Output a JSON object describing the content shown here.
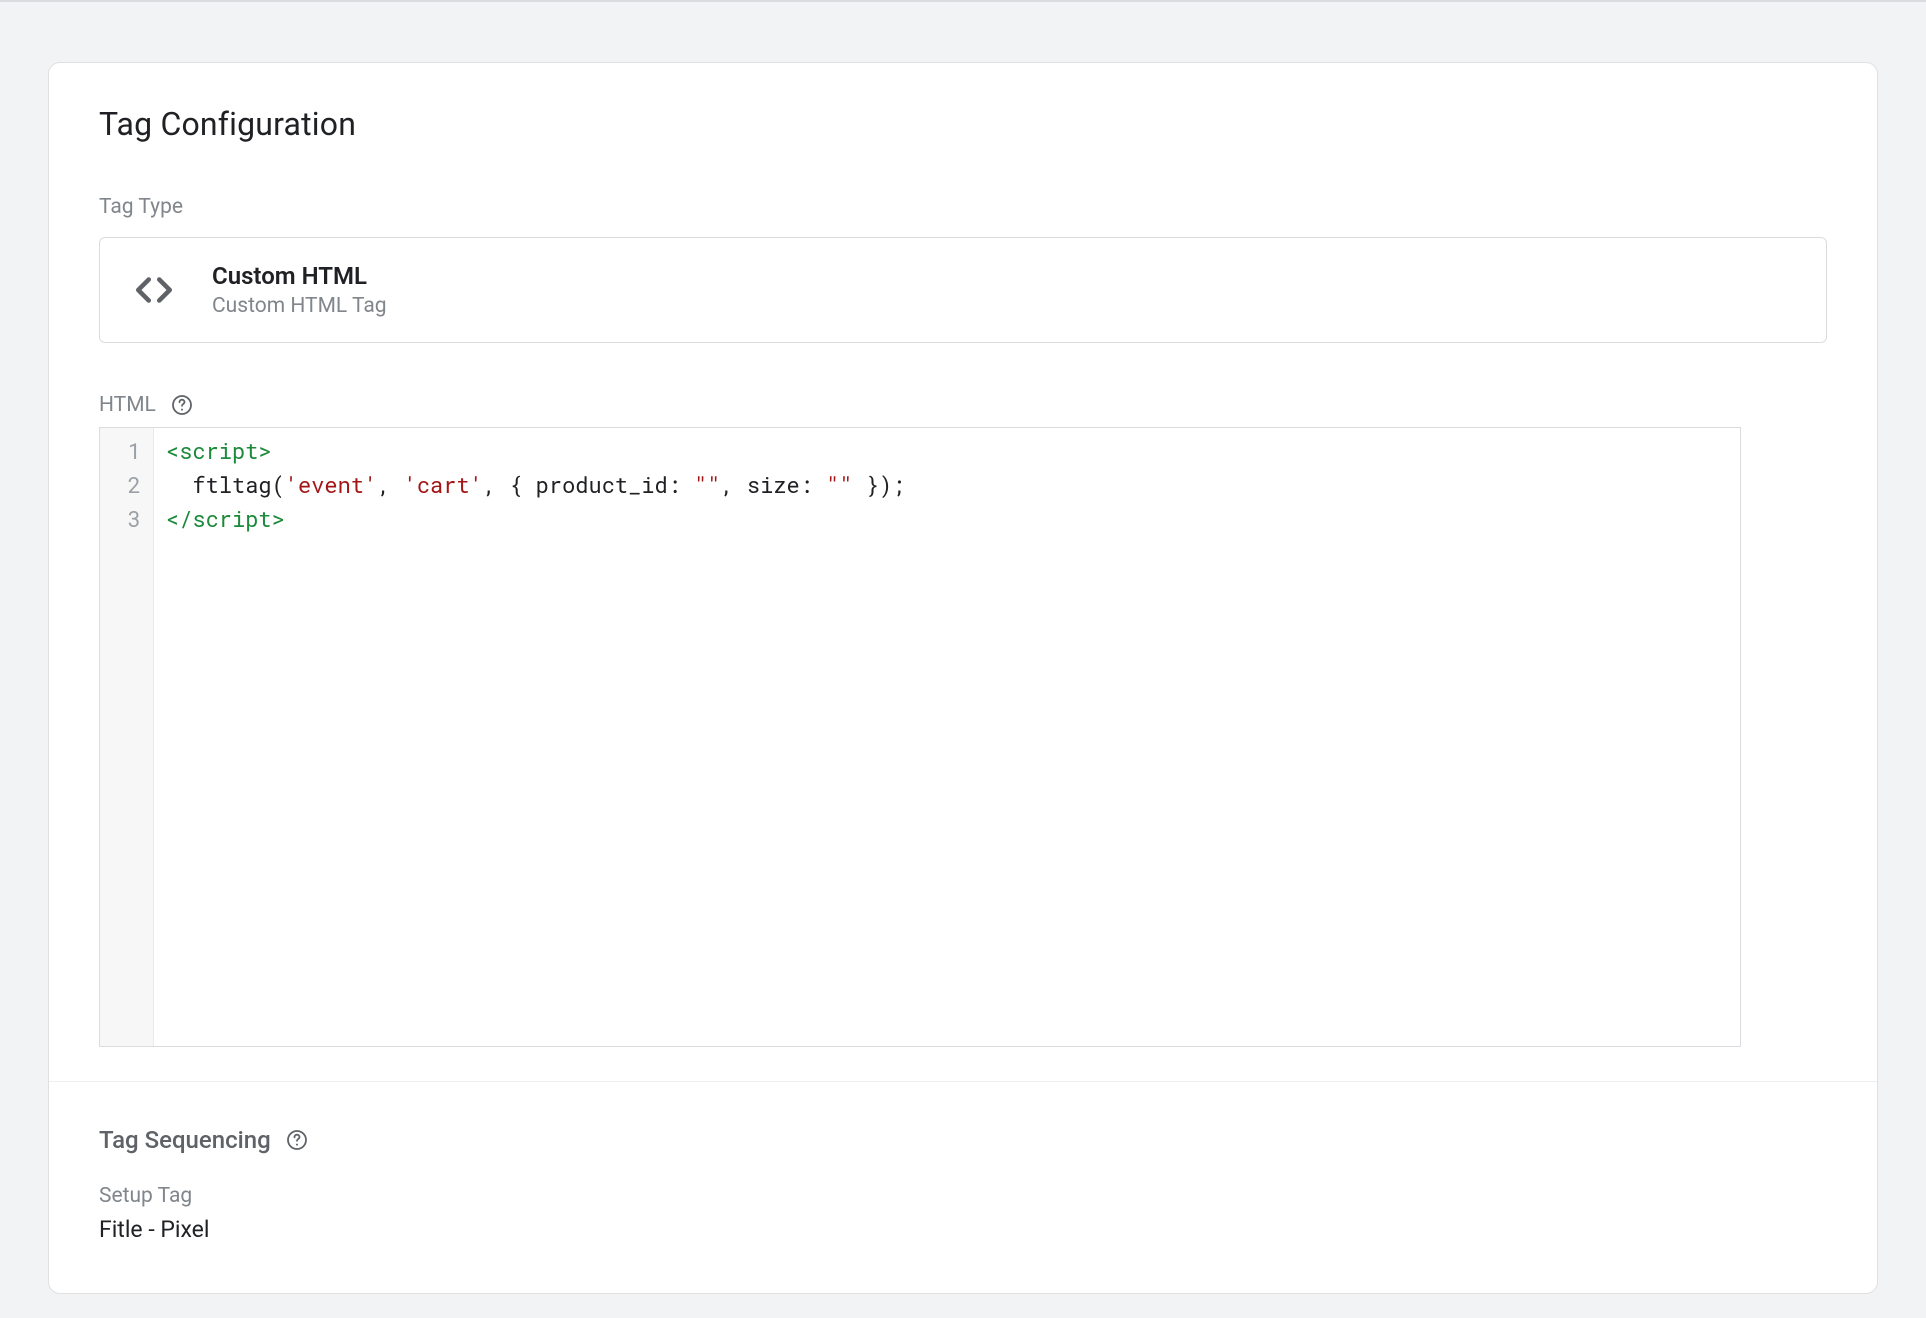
{
  "card": {
    "title": "Tag Configuration"
  },
  "tagType": {
    "fieldLabel": "Tag Type",
    "name": "Custom HTML",
    "description": "Custom HTML Tag",
    "iconName": "code-icon"
  },
  "htmlEditor": {
    "fieldLabel": "HTML",
    "lines": [
      {
        "n": "1",
        "segments": [
          {
            "t": "<script>",
            "cls": "tok-tag"
          }
        ]
      },
      {
        "n": "2",
        "segments": [
          {
            "t": "  ftltag(",
            "cls": ""
          },
          {
            "t": "'event'",
            "cls": "tok-str"
          },
          {
            "t": ", ",
            "cls": ""
          },
          {
            "t": "'cart'",
            "cls": "tok-str"
          },
          {
            "t": ", { product_id: ",
            "cls": ""
          },
          {
            "t": "\"\"",
            "cls": "tok-str"
          },
          {
            "t": ", size: ",
            "cls": ""
          },
          {
            "t": "\"\"",
            "cls": "tok-str"
          },
          {
            "t": " });",
            "cls": ""
          }
        ]
      },
      {
        "n": "3",
        "segments": [
          {
            "t": "</script>",
            "cls": "tok-tag"
          }
        ]
      }
    ]
  },
  "sequencing": {
    "heading": "Tag Sequencing",
    "setupLabel": "Setup Tag",
    "setupValue": "Fitle - Pixel"
  }
}
